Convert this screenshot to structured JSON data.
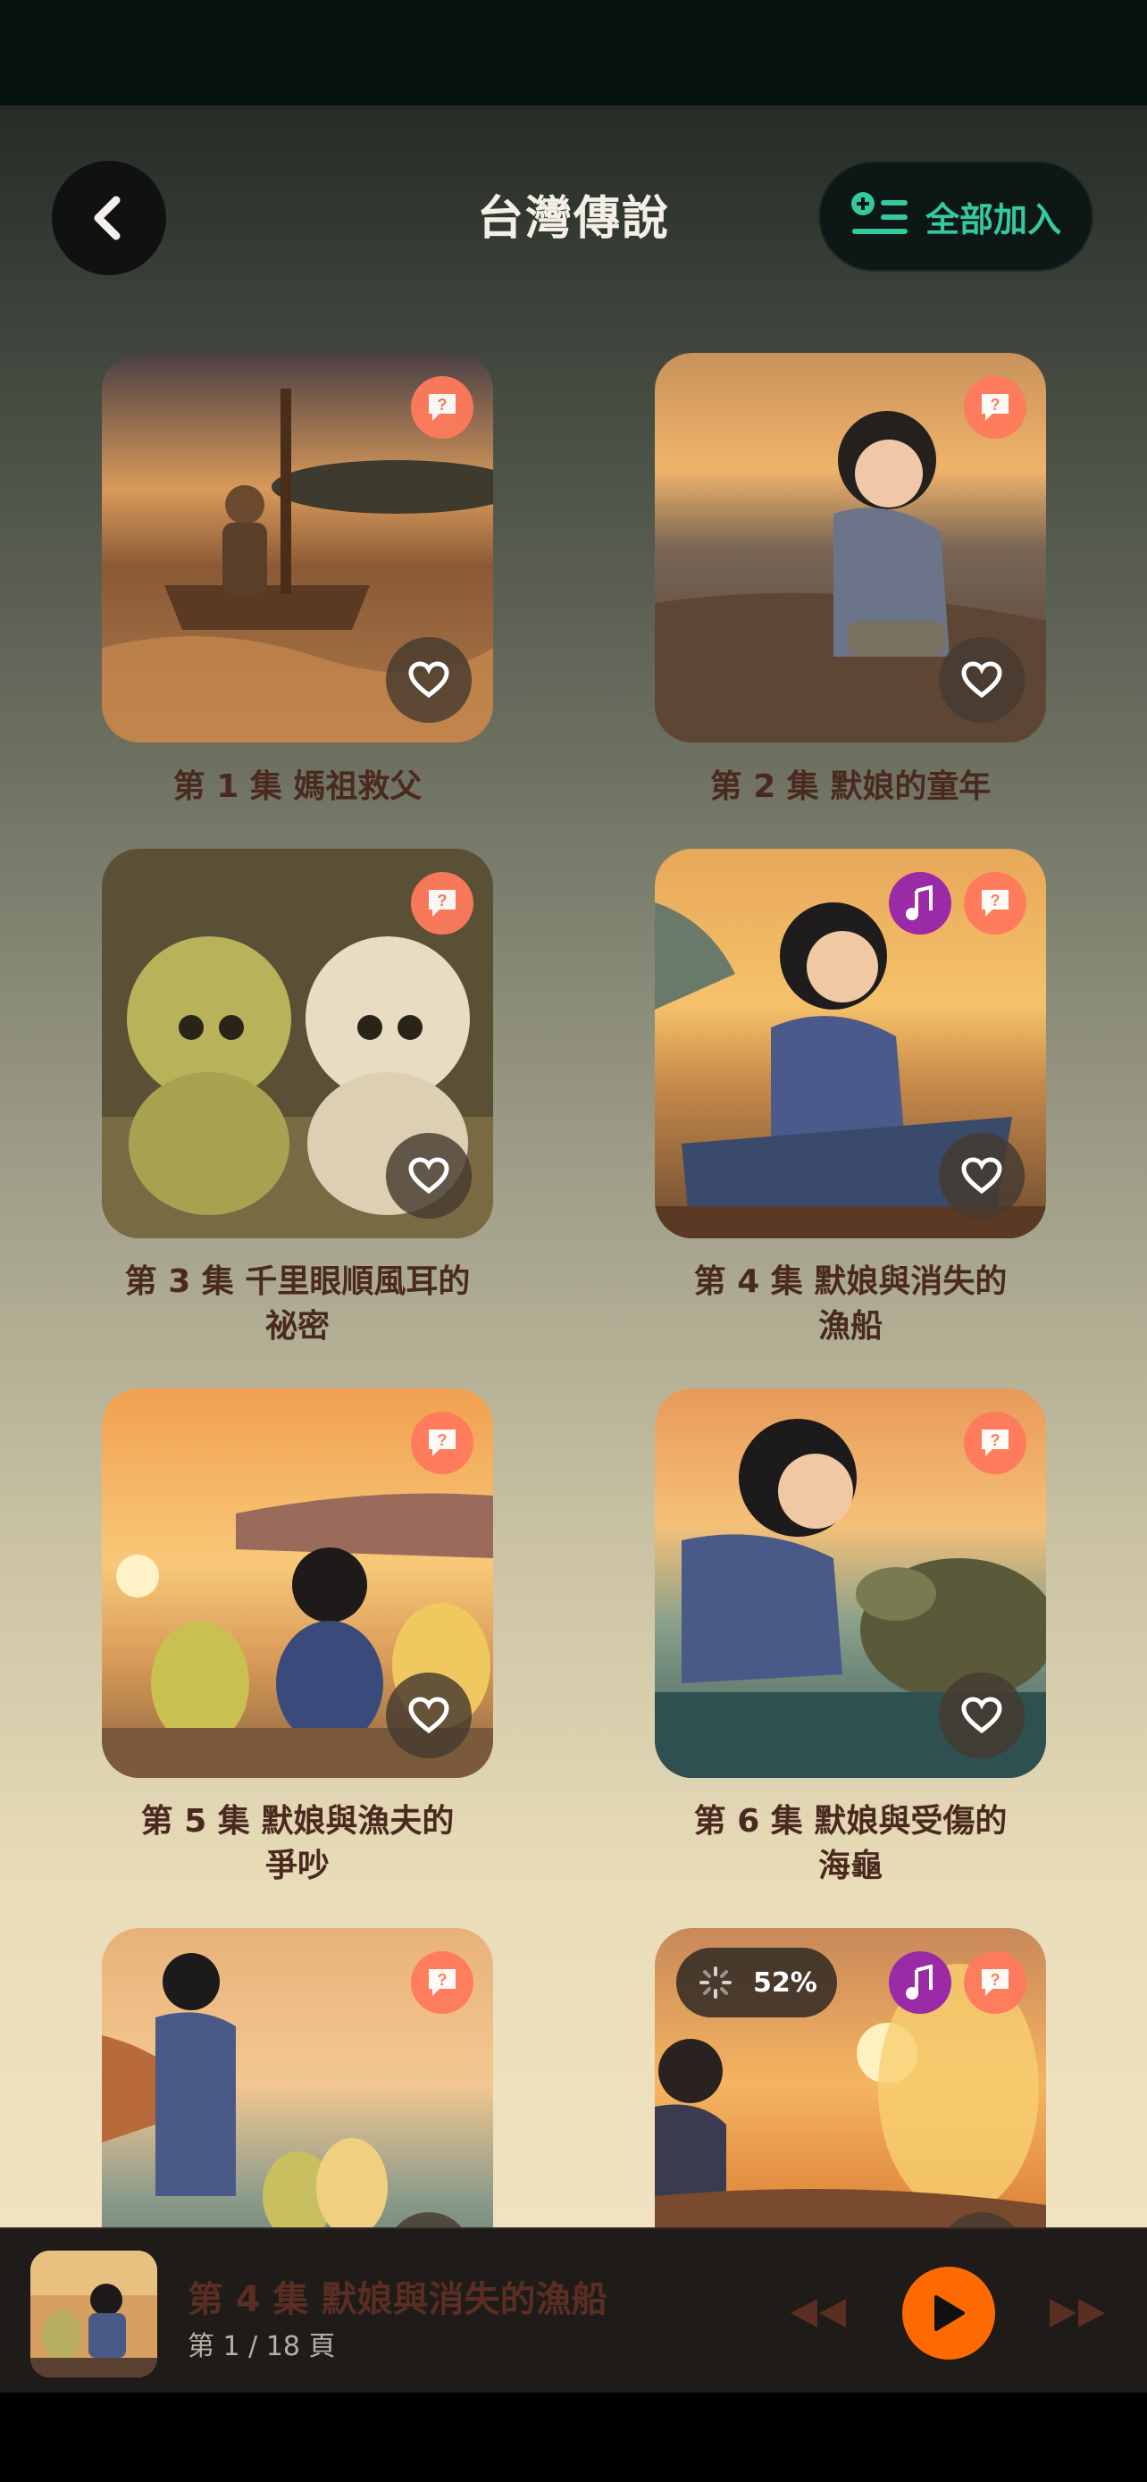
{
  "header": {
    "title": "台灣傳說",
    "add_all_label": "全部加入"
  },
  "episodes": [
    {
      "title": "第 1 集 媽祖救父",
      "has_music": false
    },
    {
      "title": "第 2 集 默娘的童年",
      "has_music": false
    },
    {
      "title_line1": "第 3 集 千里眼順風耳的",
      "title_line2": "祕密",
      "has_music": false
    },
    {
      "title_line1": "第 4 集 默娘與消失的",
      "title_line2": "漁船",
      "has_music": true
    },
    {
      "title_line1": "第 5 集 默娘與漁夫的",
      "title_line2": "爭吵",
      "has_music": false
    },
    {
      "title_line1": "第 6 集 默娘與受傷的",
      "title_line2": "海龜",
      "has_music": false
    },
    {
      "has_music": false
    },
    {
      "has_music": true,
      "progress": "52%"
    }
  ],
  "player": {
    "title": "第 4 集 默娘與消失的漁船",
    "page": "第 1 / 18 頁"
  },
  "colors": {
    "accent": "#35c99c",
    "play": "#ff6a00",
    "chat_badge": "#ff7a5c",
    "music_badge": "#9b2aa7"
  }
}
